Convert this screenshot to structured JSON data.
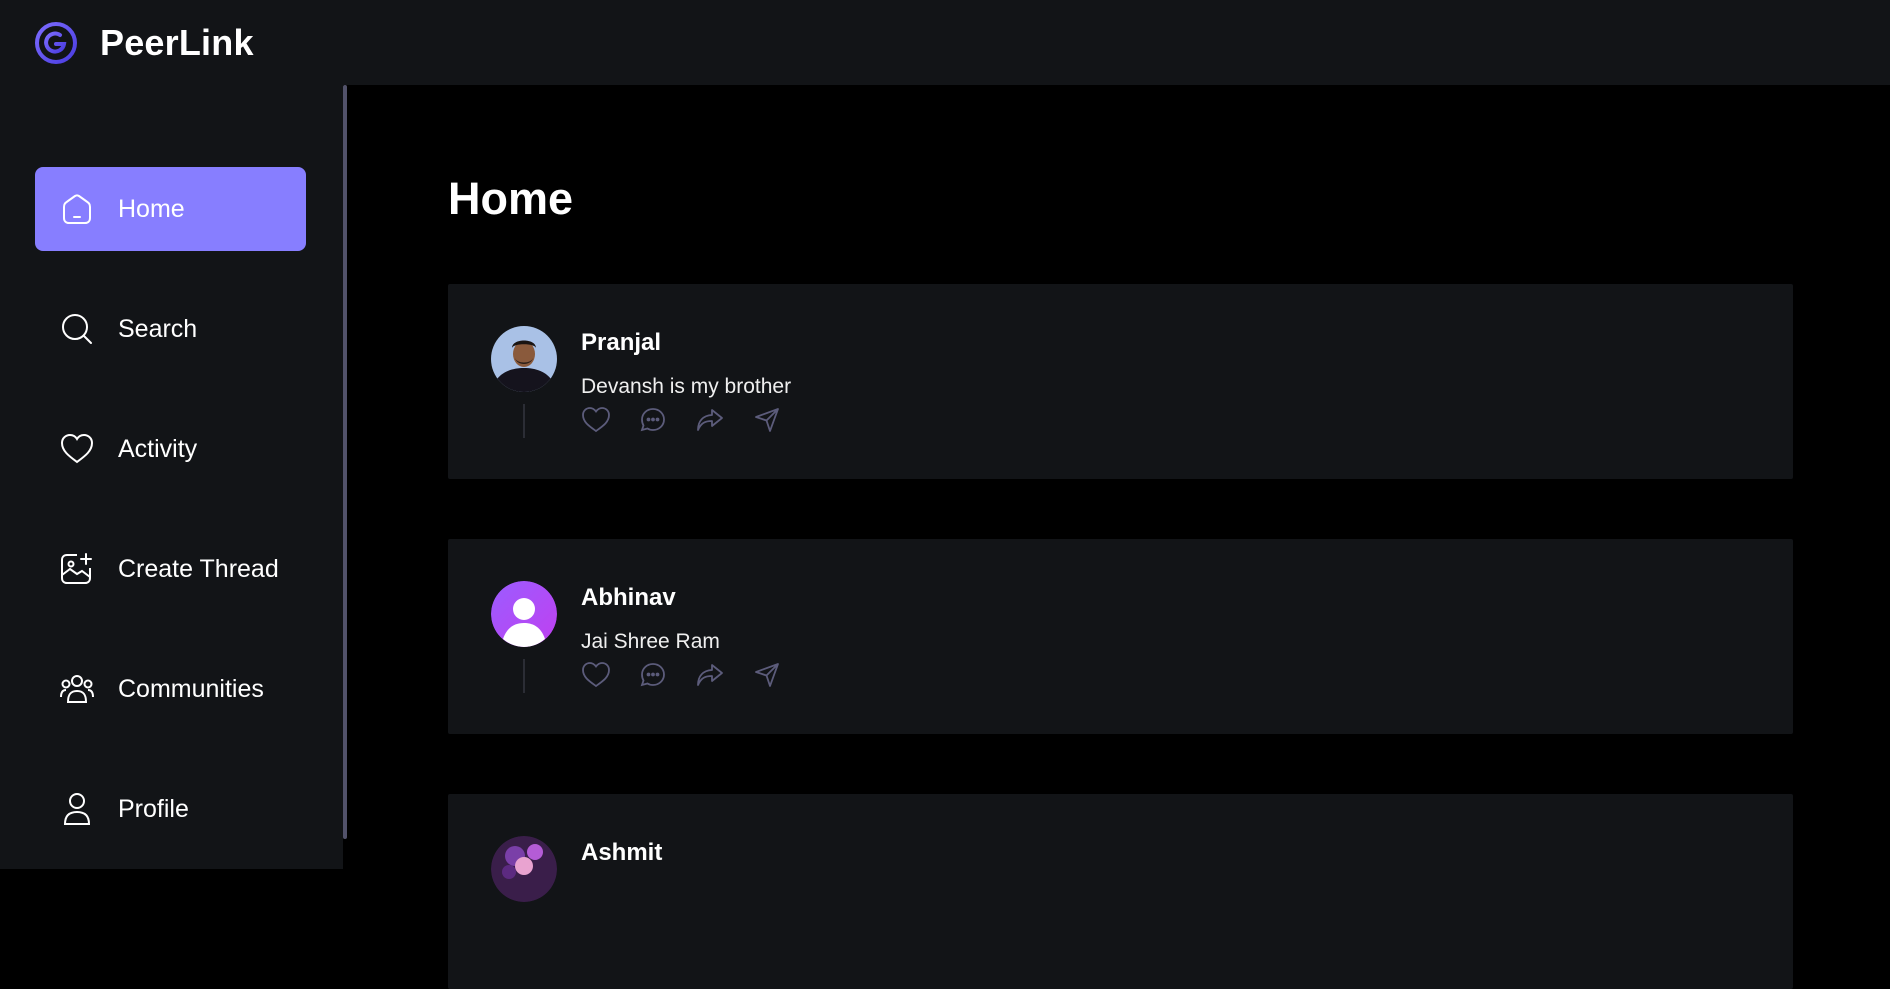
{
  "app": {
    "brand": "PeerLink"
  },
  "sidebar": {
    "items": [
      {
        "label": "Home",
        "icon": "home-icon",
        "active": true
      },
      {
        "label": "Search",
        "icon": "search-icon",
        "active": false
      },
      {
        "label": "Activity",
        "icon": "heart-icon",
        "active": false
      },
      {
        "label": "Create Thread",
        "icon": "create-icon",
        "active": false
      },
      {
        "label": "Communities",
        "icon": "community-icon",
        "active": false
      },
      {
        "label": "Profile",
        "icon": "user-icon",
        "active": false
      }
    ]
  },
  "main": {
    "title": "Home",
    "threads": [
      {
        "author": "Pranjal",
        "content": "Devansh is my brother",
        "avatar": "photo-avatar"
      },
      {
        "author": "Abhinav",
        "content": "Jai Shree Ram",
        "avatar": "default-avatar"
      },
      {
        "author": "Ashmit",
        "content": "",
        "avatar": "photo-avatar"
      }
    ]
  },
  "colors": {
    "accent": "#877eff",
    "panel": "#121417",
    "background": "#000000"
  }
}
